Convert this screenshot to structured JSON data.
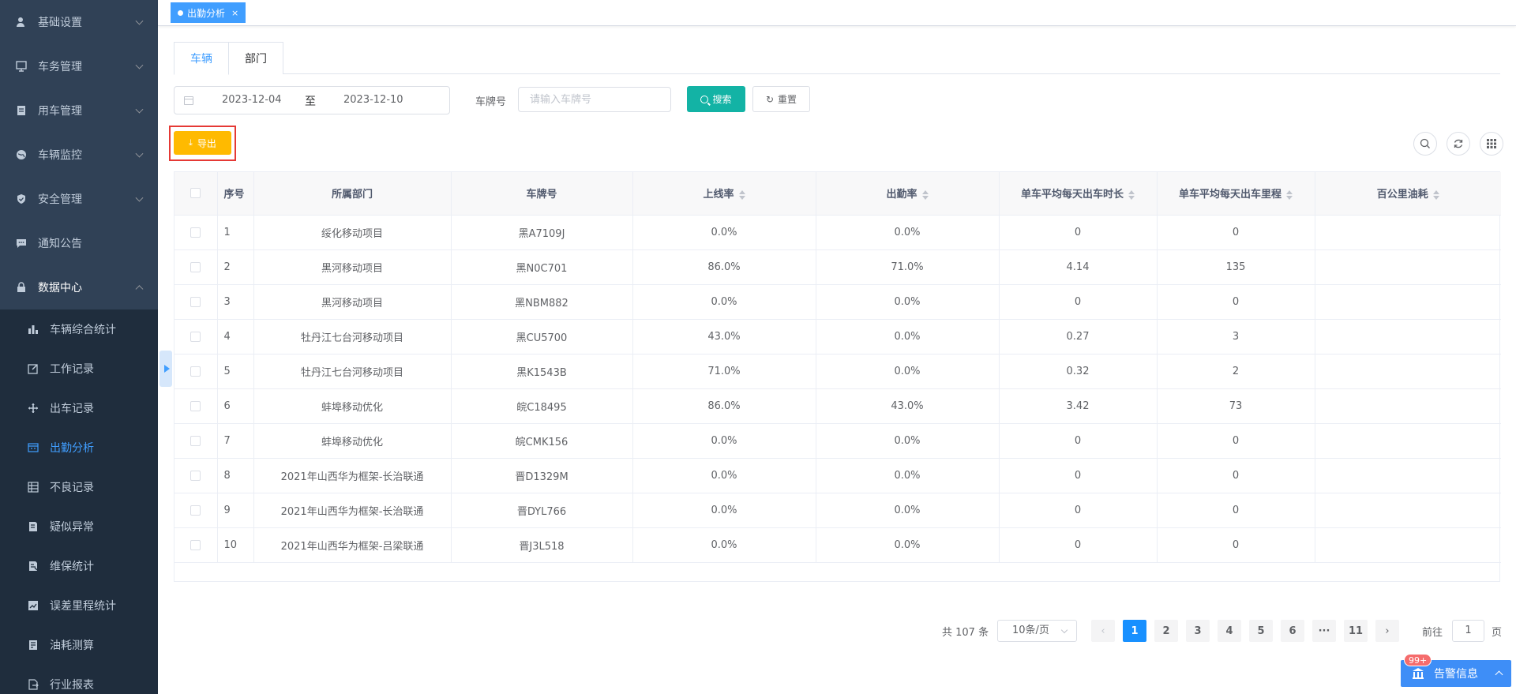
{
  "sidebar": {
    "menus": [
      {
        "label": "基础设置",
        "icon": "user-icon"
      },
      {
        "label": "车务管理",
        "icon": "monitor-icon"
      },
      {
        "label": "用车管理",
        "icon": "document-icon"
      },
      {
        "label": "车辆监控",
        "icon": "globe-icon"
      },
      {
        "label": "安全管理",
        "icon": "shield-icon"
      },
      {
        "label": "通知公告",
        "icon": "chat-icon"
      },
      {
        "label": "数据中心",
        "icon": "lock-icon"
      }
    ],
    "sub_items": [
      {
        "label": "车辆综合统计",
        "icon": "bar-chart-icon"
      },
      {
        "label": "工作记录",
        "icon": "edit-icon"
      },
      {
        "label": "出车记录",
        "icon": "move-icon"
      },
      {
        "label": "出勤分析",
        "icon": "calendar-icon"
      },
      {
        "label": "不良记录",
        "icon": "table-icon"
      },
      {
        "label": "疑似异常",
        "icon": "book-icon"
      },
      {
        "label": "维保统计",
        "icon": "clipboard-icon"
      },
      {
        "label": "误差里程统计",
        "icon": "chart-box-icon"
      },
      {
        "label": "油耗测算",
        "icon": "report-icon"
      },
      {
        "label": "行业报表",
        "icon": "export-icon"
      }
    ]
  },
  "tagsbar": {
    "active_tag": "出勤分析",
    "close": "×"
  },
  "tabs": [
    "车辆",
    "部门"
  ],
  "filter": {
    "start_date": "2023-12-04",
    "separator": "至",
    "end_date": "2023-12-10",
    "plate_label": "车牌号",
    "plate_placeholder": "请输入车牌号",
    "search_label": "搜索",
    "reset_label": "重置",
    "export_label": "导出"
  },
  "table": {
    "columns": [
      "序号",
      "所属部门",
      "车牌号",
      "上线率",
      "出勤率",
      "单车平均每天出车时长",
      "单车平均每天出车里程",
      "百公里油耗"
    ],
    "rows": [
      [
        "1",
        "绥化移动项目",
        "黑A7109J",
        "0.0%",
        "0.0%",
        "0",
        "0",
        ""
      ],
      [
        "2",
        "黑河移动项目",
        "黑N0C701",
        "86.0%",
        "71.0%",
        "4.14",
        "135",
        ""
      ],
      [
        "3",
        "黑河移动项目",
        "黑NBM882",
        "0.0%",
        "0.0%",
        "0",
        "0",
        ""
      ],
      [
        "4",
        "牡丹江七台河移动项目",
        "黑CU5700",
        "43.0%",
        "0.0%",
        "0.27",
        "3",
        ""
      ],
      [
        "5",
        "牡丹江七台河移动项目",
        "黑K1543B",
        "71.0%",
        "0.0%",
        "0.32",
        "2",
        ""
      ],
      [
        "6",
        "蚌埠移动优化",
        "皖C18495",
        "86.0%",
        "43.0%",
        "3.42",
        "73",
        ""
      ],
      [
        "7",
        "蚌埠移动优化",
        "皖CMK156",
        "0.0%",
        "0.0%",
        "0",
        "0",
        ""
      ],
      [
        "8",
        "2021年山西华为框架-长治联通",
        "晋D1329M",
        "0.0%",
        "0.0%",
        "0",
        "0",
        ""
      ],
      [
        "9",
        "2021年山西华为框架-长治联通",
        "晋DYL766",
        "0.0%",
        "0.0%",
        "0",
        "0",
        ""
      ],
      [
        "10",
        "2021年山西华为框架-吕梁联通",
        "晋J3L518",
        "0.0%",
        "0.0%",
        "0",
        "0",
        ""
      ]
    ]
  },
  "pagination": {
    "total": "共 107 条",
    "page_size": "10条/页",
    "pages": [
      "1",
      "2",
      "3",
      "4",
      "5",
      "6",
      "···",
      "11"
    ],
    "current": "1",
    "goto_label": "前往",
    "goto_value": "1",
    "page_suffix": "页"
  },
  "alert": {
    "badge": "99+",
    "label": "告警信息"
  },
  "colors": {
    "sidebar_bg": "#304156",
    "submenu_bg": "#1f2d3d",
    "primary": "#409eff",
    "search_btn": "#13b3a5",
    "export_btn": "#ffba00",
    "highlight_border": "#e53935"
  }
}
